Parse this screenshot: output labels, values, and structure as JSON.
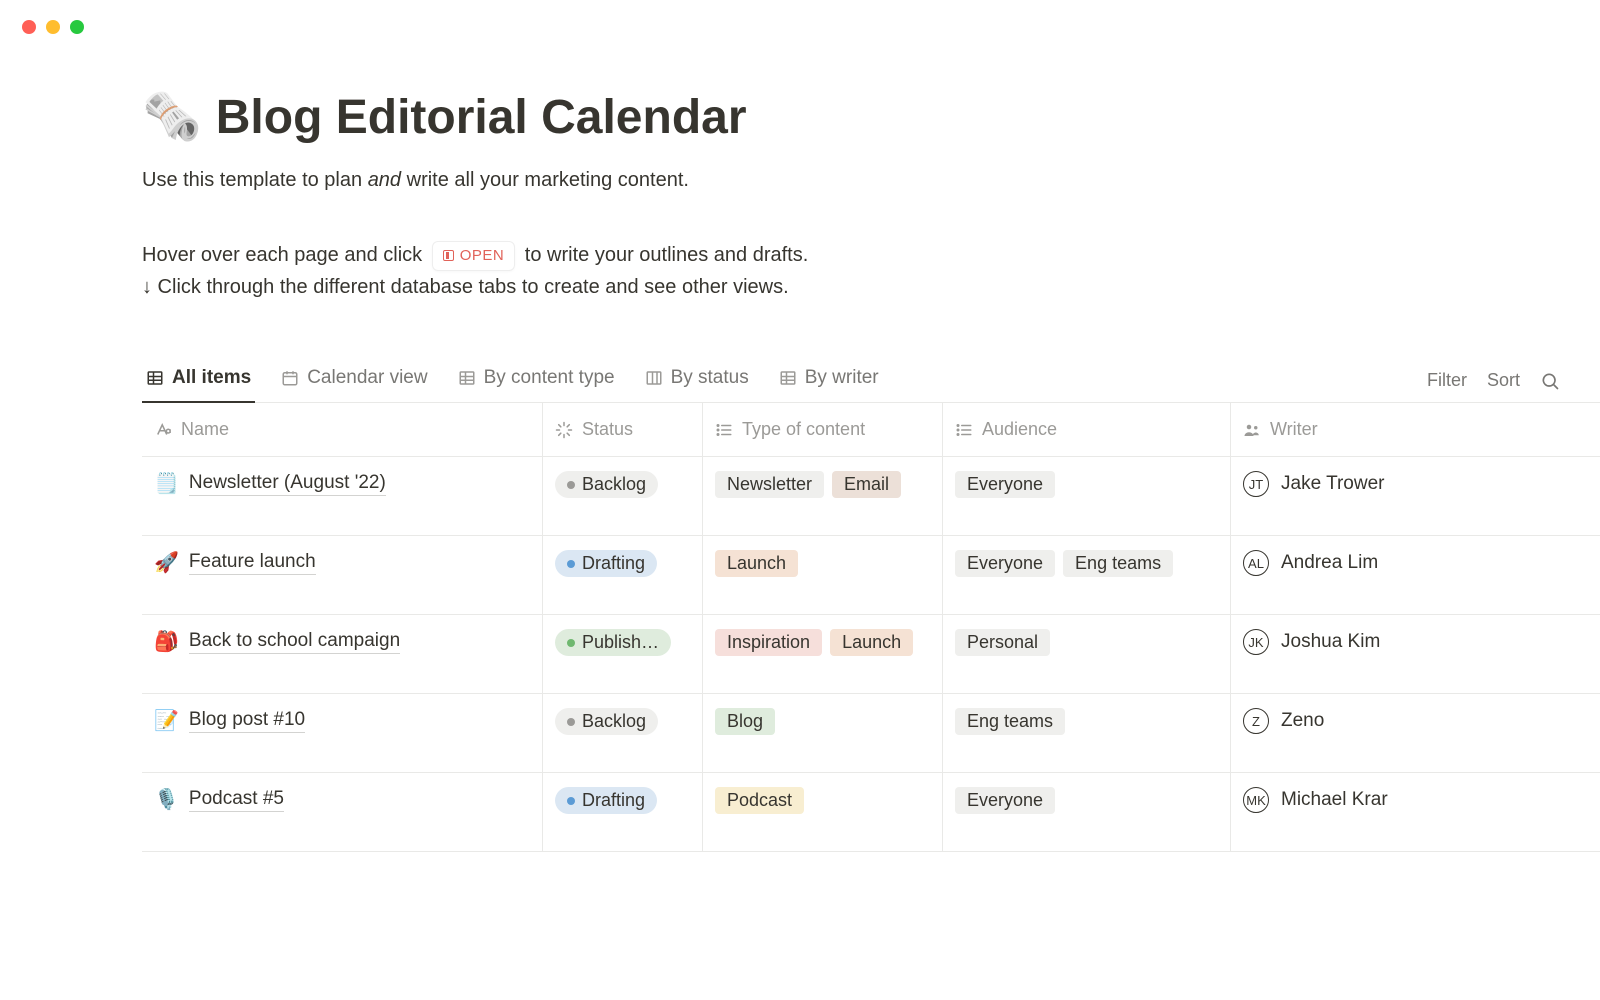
{
  "page": {
    "icon": "🗞️",
    "title": "Blog Editorial Calendar",
    "subtitle_a": "Use this template to plan ",
    "subtitle_and": "and",
    "subtitle_b": " write all your marketing content.",
    "instruction_line1_a": "Hover over each page and click ",
    "open_label": "OPEN",
    "instruction_line1_b": " to write your outlines and drafts.",
    "instruction_line2": "↓ Click through the different database tabs to create and see other views."
  },
  "toolbar": {
    "filter": "Filter",
    "sort": "Sort"
  },
  "tabs": [
    {
      "label": "All items",
      "icon": "table",
      "active": true
    },
    {
      "label": "Calendar view",
      "icon": "calendar",
      "active": false
    },
    {
      "label": "By content type",
      "icon": "table",
      "active": false
    },
    {
      "label": "By status",
      "icon": "board",
      "active": false
    },
    {
      "label": "By writer",
      "icon": "table",
      "active": false
    }
  ],
  "columns": {
    "name": "Name",
    "status": "Status",
    "type": "Type of content",
    "audience": "Audience",
    "writer": "Writer"
  },
  "rows": [
    {
      "emoji": "🗒️",
      "name": "Newsletter (August '22)",
      "status": {
        "label": "Backlog",
        "color": "gray"
      },
      "types": [
        {
          "label": "Newsletter",
          "color": "gray"
        },
        {
          "label": "Email",
          "color": "brown"
        }
      ],
      "audience": [
        {
          "label": "Everyone",
          "color": "gray"
        }
      ],
      "writer": "Jake Trower"
    },
    {
      "emoji": "🚀",
      "name": "Feature launch",
      "status": {
        "label": "Drafting",
        "color": "blue"
      },
      "types": [
        {
          "label": "Launch",
          "color": "orange"
        }
      ],
      "audience": [
        {
          "label": "Everyone",
          "color": "gray"
        },
        {
          "label": "Eng teams",
          "color": "gray"
        }
      ],
      "writer": "Andrea Lim"
    },
    {
      "emoji": "🎒",
      "name": "Back to school campaign",
      "status": {
        "label": "Publish…",
        "color": "green"
      },
      "types": [
        {
          "label": "Inspiration",
          "color": "red"
        },
        {
          "label": "Launch",
          "color": "orange"
        }
      ],
      "audience": [
        {
          "label": "Personal",
          "color": "gray"
        }
      ],
      "writer": "Joshua Kim"
    },
    {
      "emoji": "📝",
      "name": "Blog post #10",
      "status": {
        "label": "Backlog",
        "color": "gray"
      },
      "types": [
        {
          "label": "Blog",
          "color": "green"
        }
      ],
      "audience": [
        {
          "label": "Eng teams",
          "color": "gray"
        }
      ],
      "writer": "Zeno"
    },
    {
      "emoji": "🎙️",
      "name": "Podcast #5",
      "status": {
        "label": "Drafting",
        "color": "blue"
      },
      "types": [
        {
          "label": "Podcast",
          "color": "yellow"
        }
      ],
      "audience": [
        {
          "label": "Everyone",
          "color": "gray"
        }
      ],
      "writer": "Michael Krar"
    }
  ]
}
